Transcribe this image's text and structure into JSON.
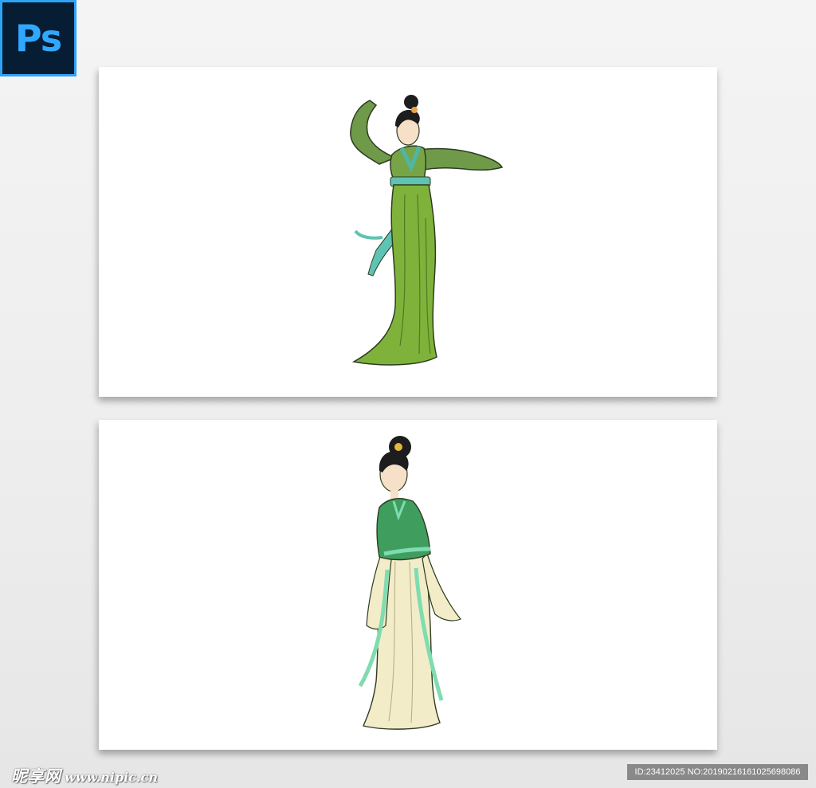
{
  "logo": {
    "text": "Ps",
    "background": "#071d33",
    "accent": "#31a8ff"
  },
  "cards": [
    {
      "figure": "dancing-lady-green-robe-icon",
      "colors": {
        "robe": "#7fb23a",
        "sleeve": "#6f9a4a",
        "sash": "#5fc3b3"
      }
    },
    {
      "figure": "standing-lady-cream-dress-icon",
      "colors": {
        "jacket": "#3f9e5e",
        "dress": "#f2ecc8",
        "ribbon": "#7fdcb0"
      }
    }
  ],
  "watermark": {
    "brand": "昵享网",
    "url": "www.nipic.cn",
    "id_line": "ID:23412025 NO:20190216161025698086"
  }
}
